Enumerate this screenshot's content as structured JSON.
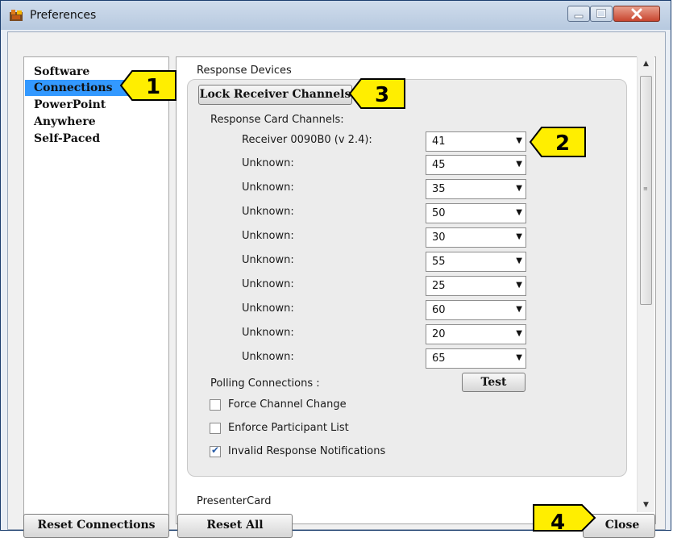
{
  "window": {
    "title": "Preferences"
  },
  "nav": {
    "items": [
      {
        "label": "Software",
        "selected": false
      },
      {
        "label": "Connections",
        "selected": true
      },
      {
        "label": "PowerPoint",
        "selected": false
      },
      {
        "label": "Anywhere",
        "selected": false
      },
      {
        "label": "Self-Paced",
        "selected": false
      }
    ]
  },
  "section": {
    "title": "Response Devices",
    "lock_button": "Lock Receiver Channels",
    "channels_label": "Response Card Channels:",
    "receivers": [
      {
        "label": "Receiver 0090B0 (v 2.4):",
        "channel": "41"
      },
      {
        "label": "Unknown:",
        "channel": "45"
      },
      {
        "label": "Unknown:",
        "channel": "35"
      },
      {
        "label": "Unknown:",
        "channel": "50"
      },
      {
        "label": "Unknown:",
        "channel": "30"
      },
      {
        "label": "Unknown:",
        "channel": "55"
      },
      {
        "label": "Unknown:",
        "channel": "25"
      },
      {
        "label": "Unknown:",
        "channel": "60"
      },
      {
        "label": "Unknown:",
        "channel": "20"
      },
      {
        "label": "Unknown:",
        "channel": "65"
      }
    ],
    "polling_label": "Polling Connections :",
    "test_button": "Test",
    "checkboxes": [
      {
        "label": "Force Channel Change",
        "checked": false
      },
      {
        "label": "Enforce Participant List",
        "checked": false
      },
      {
        "label": "Invalid Response Notifications",
        "checked": true
      }
    ]
  },
  "next_section": {
    "title": "PresenterCard"
  },
  "footer": {
    "reset_connections": "Reset Connections",
    "reset_all": "Reset All",
    "close": "Close"
  },
  "callouts": [
    "1",
    "2",
    "3",
    "4"
  ],
  "colors": {
    "selection": "#3399ff",
    "callout_fill": "#ffee00",
    "close_button": "#c8462f"
  }
}
